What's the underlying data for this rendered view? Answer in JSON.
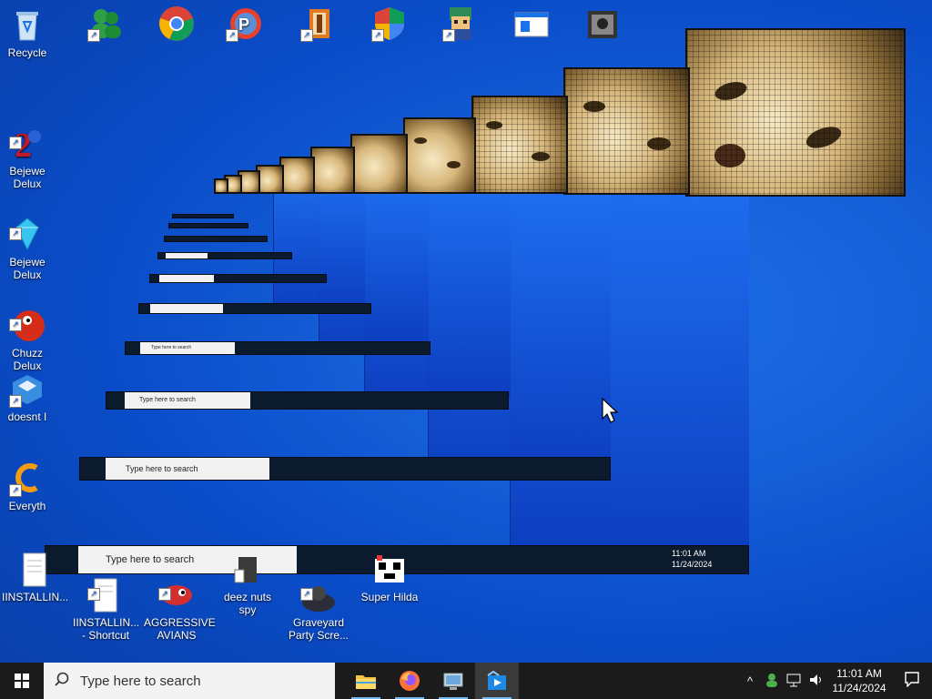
{
  "desktop": {
    "icons_left": [
      {
        "name": "recycle-bin",
        "label": "Recycle",
        "icon": "recycle-bin-icon"
      },
      {
        "name": "bejeweled-2",
        "label": "Bejewe\nDelux",
        "icon": "bejeweled-2-icon"
      },
      {
        "name": "bejeweled-gem",
        "label": "Bejewe\nDelux",
        "icon": "gem-icon"
      },
      {
        "name": "chuzzle",
        "label": "Chuzz\nDelux",
        "icon": "chuzzle-icon"
      },
      {
        "name": "doesnt-i",
        "label": "doesnt I",
        "icon": "doesnt-icon"
      },
      {
        "name": "everything",
        "label": "Everyth",
        "icon": "everything-icon"
      }
    ],
    "icons_bottom": [
      {
        "name": "installing-1",
        "label": "IINSTALLIN...",
        "icon": "document-icon"
      },
      {
        "name": "installing-shortcut",
        "label": "IINSTALLIN...\n- Shortcut",
        "icon": "document-icon"
      },
      {
        "name": "aggressive-avians",
        "label": "AGGRESSIVE\nAVIANS",
        "icon": "bird-icon"
      },
      {
        "name": "deez-nuts-spy",
        "label": "deez nuts spy",
        "icon": "spy-icon"
      },
      {
        "name": "graveyard-party",
        "label": "Graveyard\nParty Scre...",
        "icon": "graveyard-icon"
      },
      {
        "name": "super-hilda",
        "label": "Super Hilda",
        "icon": "pixel-game-icon"
      }
    ],
    "icons_top": [
      {
        "name": "people-app",
        "icon": "people-icon"
      },
      {
        "name": "chrome",
        "icon": "chrome-icon"
      },
      {
        "name": "p-app",
        "icon": "p-app-icon"
      },
      {
        "name": "winrar-like",
        "icon": "archive-icon"
      },
      {
        "name": "shield-app",
        "icon": "shield-icon"
      },
      {
        "name": "anime-char",
        "icon": "character-icon"
      },
      {
        "name": "window-app",
        "icon": "window-icon"
      },
      {
        "name": "photo-app",
        "icon": "photo-icon"
      }
    ]
  },
  "taskbar": {
    "search_placeholder": "Type here to search",
    "apps": [
      {
        "name": "file-explorer",
        "icon": "folder-icon",
        "state": "running"
      },
      {
        "name": "firefox",
        "icon": "firefox-icon",
        "state": "running"
      },
      {
        "name": "control-panel",
        "icon": "control-panel-icon",
        "state": "running"
      },
      {
        "name": "media-app",
        "icon": "media-icon",
        "state": "active"
      }
    ],
    "tray": {
      "chevron": "^",
      "time": "11:01 AM",
      "date": "11/24/2024"
    }
  },
  "trail": {
    "search_text": "Type here to search",
    "time": "11:01 AM",
    "date": "11/24/2024"
  },
  "colors": {
    "desktop_blue": "#1560d8",
    "taskbar": "#1b1b1b",
    "search_bg": "#f3f3f3",
    "running_indicator": "#76b9ed"
  }
}
